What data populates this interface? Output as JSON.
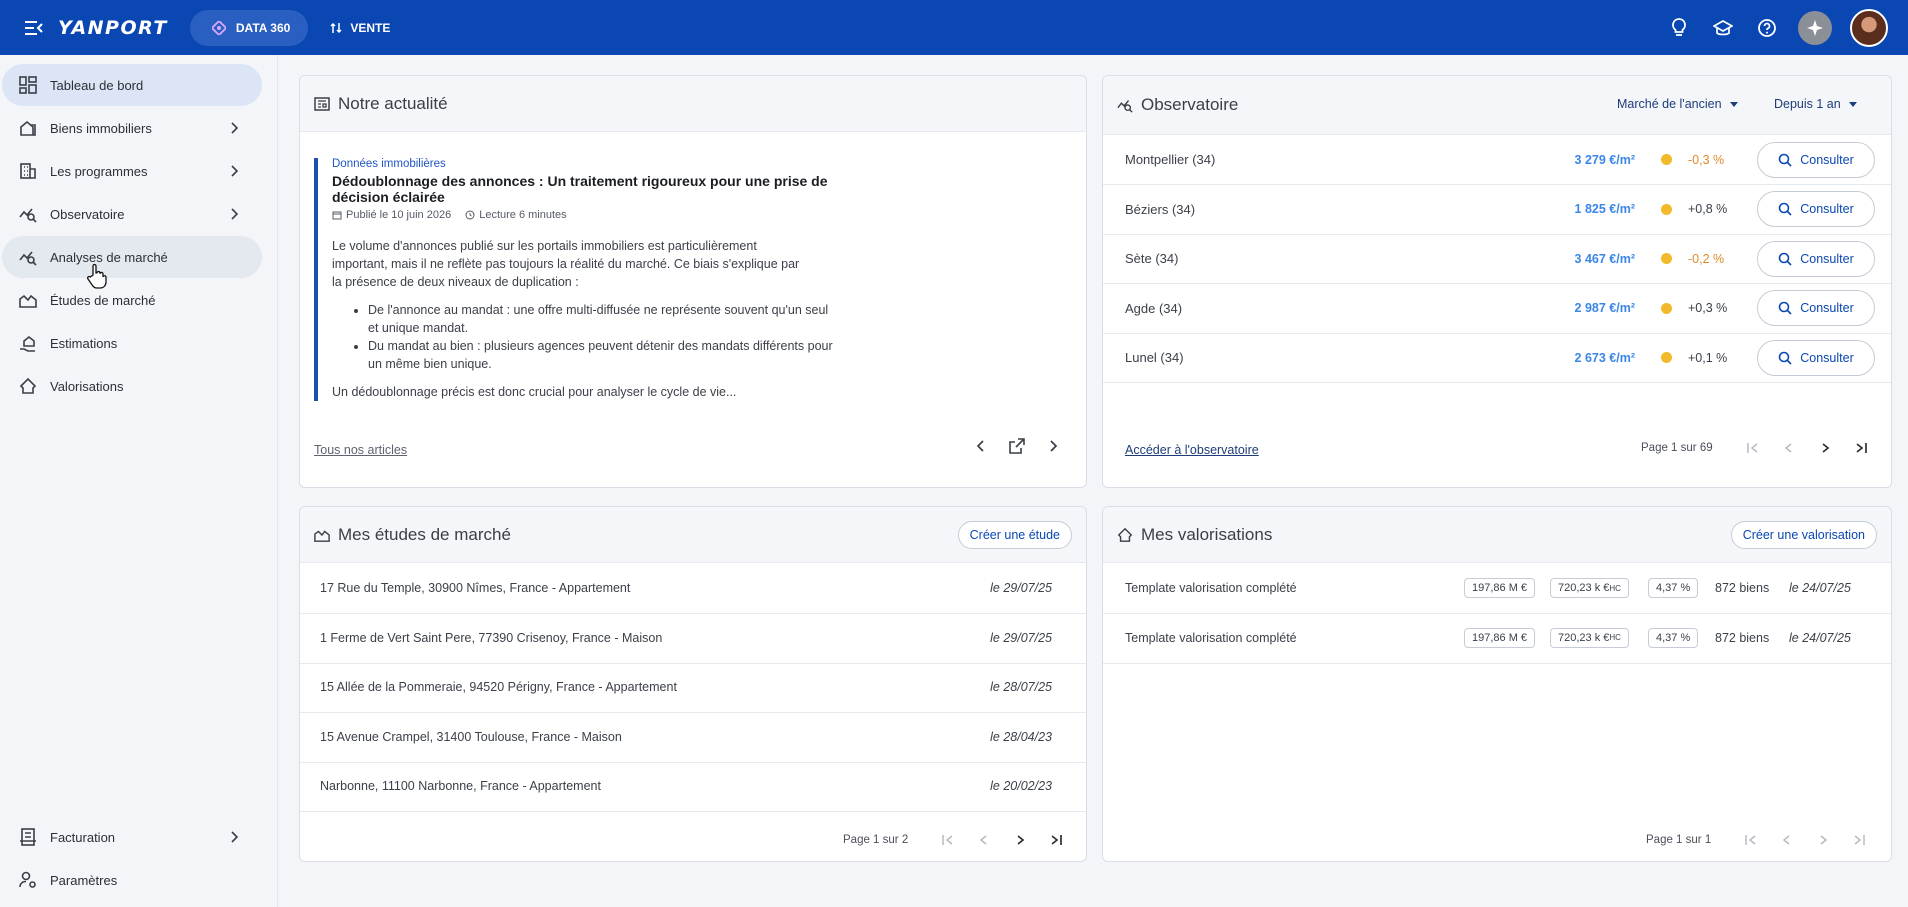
{
  "header": {
    "logo": "YANPORT",
    "data360_label": "DATA 360",
    "vente_label": "VENTE"
  },
  "sidebar": {
    "items": [
      {
        "label": "Tableau de bord"
      },
      {
        "label": "Biens immobiliers"
      },
      {
        "label": "Les programmes"
      },
      {
        "label": "Observatoire"
      },
      {
        "label": "Analyses de marché"
      },
      {
        "label": "Études de marché"
      },
      {
        "label": "Estimations"
      },
      {
        "label": "Valorisations"
      }
    ],
    "bottom": [
      {
        "label": "Facturation"
      },
      {
        "label": "Paramètres"
      }
    ]
  },
  "actualite": {
    "title": "Notre actualité",
    "tag": "Données immobilières",
    "article_title": "Dédoublonnage des annonces : Un traitement rigoureux pour une prise de décision éclairée",
    "published": "Publié le 10 juin 2026",
    "reading": "Lecture 6 minutes",
    "para1": "Le volume d'annonces publié sur les portails immobiliers est particulièrement important, mais il ne reflète pas toujours la réalité du marché. Ce biais s'explique par la présence de deux niveaux de duplication :",
    "bullet1": "De l'annonce au mandat : une offre multi-diffusée ne représente souvent qu'un seul et unique mandat.",
    "bullet2": "Du mandat au bien : plusieurs agences peuvent détenir des mandats différents pour un même bien unique.",
    "para2": "Un dédoublonnage précis est donc crucial pour analyser le cycle de vie...",
    "all_link": "Tous nos articles"
  },
  "observatoire": {
    "title": "Observatoire",
    "filter_market": "Marché de l'ancien",
    "filter_period": "Depuis 1 an",
    "consult_label": "Consulter",
    "rows": [
      {
        "city": "Montpellier (34)",
        "price": "3 279 €/m²",
        "variation": "-0,3 %",
        "var_color": "#e0892a"
      },
      {
        "city": "Béziers (34)",
        "price": "1 825 €/m²",
        "variation": "+0,8 %",
        "var_color": "#3b4049"
      },
      {
        "city": "Sète (34)",
        "price": "3 467 €/m²",
        "variation": "-0,2 %",
        "var_color": "#e0892a"
      },
      {
        "city": "Agde (34)",
        "price": "2 987 €/m²",
        "variation": "+0,3 %",
        "var_color": "#3b4049"
      },
      {
        "city": "Lunel (34)",
        "price": "2 673 €/m²",
        "variation": "+0,1 %",
        "var_color": "#3b4049"
      }
    ],
    "link": "Accéder à l'observatoire",
    "page": "Page 1 sur 69"
  },
  "etudes": {
    "title": "Mes études de marché",
    "create_label": "Créer une étude",
    "rows": [
      {
        "address": "17 Rue du Temple, 30900 Nîmes, France - Appartement",
        "date": "le 29/07/25"
      },
      {
        "address": "1 Ferme de Vert Saint Pere, 77390 Crisenoy, France - Maison",
        "date": "le 29/07/25"
      },
      {
        "address": "15 Allée de la Pommeraie, 94520 Périgny, France - Appartement",
        "date": "le 28/07/25"
      },
      {
        "address": "15 Avenue Crampel, 31400 Toulouse, France - Maison",
        "date": "le 28/04/23"
      },
      {
        "address": "Narbonne, 11100 Narbonne, France - Appartement",
        "date": "le 20/02/23"
      }
    ],
    "page": "Page 1 sur 2"
  },
  "valorisations": {
    "title": "Mes valorisations",
    "create_label": "Créer une valorisation",
    "rows": [
      {
        "name": "Template valorisation complété",
        "value": "197,86 M €",
        "amount": "720,23 k €",
        "amount_sup": "HC",
        "rate": "4,37 %",
        "count": "872 biens",
        "date": "le 24/07/25"
      },
      {
        "name": "Template valorisation complété",
        "value": "197,86 M €",
        "amount": "720,23 k €",
        "amount_sup": "HC",
        "rate": "4,37 %",
        "count": "872 biens",
        "date": "le 24/07/25"
      }
    ],
    "page": "Page 1 sur 1"
  },
  "colors": {
    "brand": "#0b47b3",
    "price": "#3b86e6",
    "dot": "#f2b92a",
    "negative": "#e0892a"
  }
}
